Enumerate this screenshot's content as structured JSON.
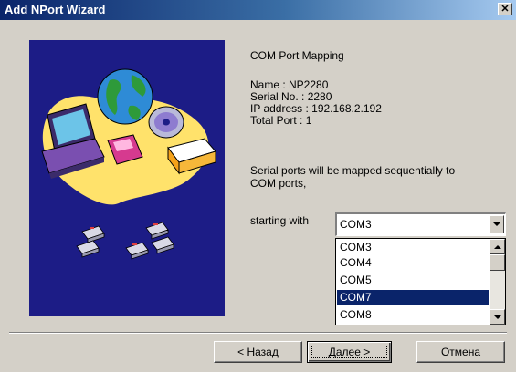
{
  "window": {
    "title": "Add NPort Wizard",
    "close_glyph": "✕"
  },
  "content": {
    "heading": "COM Port Mapping",
    "name_line": "Name : NP2280",
    "serial_line": "Serial No. : 2280",
    "ip_line": "IP address : 192.168.2.192",
    "total_line": "Total Port : 1",
    "description_line1": "Serial ports will be mapped sequentially to",
    "description_line2": "COM ports,",
    "starting_label": "starting with"
  },
  "combo": {
    "selected": "COM3",
    "options": [
      "COM3",
      "COM4",
      "COM5",
      "COM7",
      "COM8"
    ],
    "highlighted": "COM7"
  },
  "buttons": {
    "back": "< Назад",
    "next": "Далее >",
    "cancel": "Отмена"
  },
  "colors": {
    "title_bar": "#0a246a",
    "art_background": "#1c1c86",
    "selection": "#0a246a",
    "dialog_face": "#d4d0c8"
  },
  "illustration": {
    "icons": [
      "computer-icon",
      "globe-icon",
      "cd-icon",
      "diskette-icon",
      "tray-icon",
      "network-stations-icon"
    ]
  }
}
